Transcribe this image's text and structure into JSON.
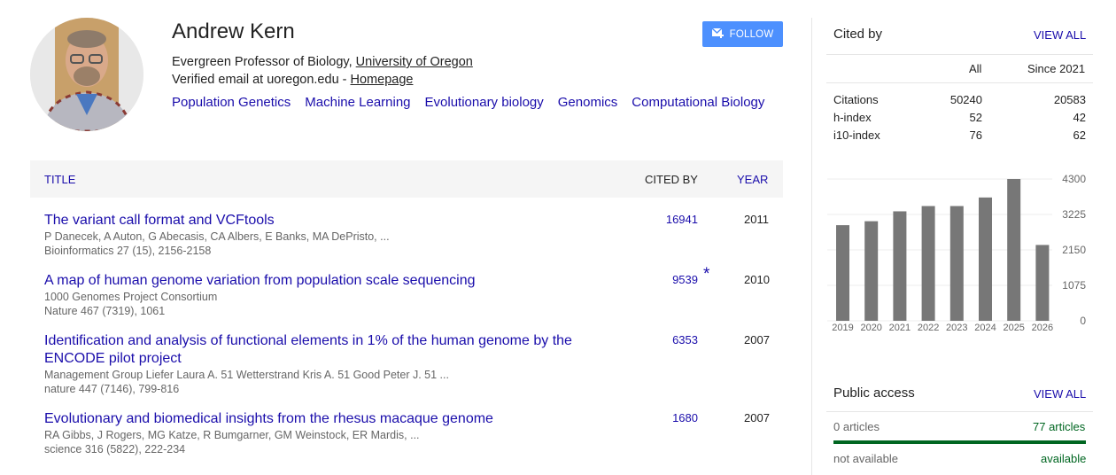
{
  "profile": {
    "name": "Andrew Kern",
    "affiliation_prefix": "Evergreen Professor of Biology, ",
    "affiliation_link": "University of Oregon",
    "email_prefix": "Verified email at uoregon.edu - ",
    "homepage_link": "Homepage",
    "interests": [
      "Population Genetics",
      "Machine Learning",
      "Evolutionary biology",
      "Genomics",
      "Computational Biology"
    ],
    "follow_label": "FOLLOW"
  },
  "table": {
    "headers": {
      "title": "TITLE",
      "cited_by": "CITED BY",
      "year": "YEAR"
    },
    "rows": [
      {
        "title": "The variant call format and VCFtools",
        "authors": "P Danecek, A Auton, G Abecasis, CA Albers, E Banks, MA DePristo, ...",
        "venue": "Bioinformatics 27 (15), 2156-2158",
        "cited": "16941",
        "year": "2011",
        "star": ""
      },
      {
        "title": "A map of human genome variation from population scale sequencing",
        "authors": "1000 Genomes Project Consortium",
        "venue": "Nature 467 (7319), 1061",
        "cited": "9539",
        "year": "2010",
        "star": "*"
      },
      {
        "title": "Identification and analysis of functional elements in 1% of the human genome by the ENCODE pilot project",
        "authors": "Management Group Liefer Laura A. 51 Wetterstrand Kris A. 51 Good Peter J. 51 ...",
        "venue": "nature 447 (7146), 799-816",
        "cited": "6353",
        "year": "2007",
        "star": ""
      },
      {
        "title": "Evolutionary and biomedical insights from the rhesus macaque genome",
        "authors": "RA Gibbs, J Rogers, MG Katze, R Bumgarner, GM Weinstock, ER Mardis, ...",
        "venue": "science 316 (5822), 222-234",
        "cited": "1680",
        "year": "2007",
        "star": ""
      }
    ]
  },
  "cited_by": {
    "heading": "Cited by",
    "view_all": "VIEW ALL",
    "col_all": "All",
    "col_since": "Since 2021",
    "stats": [
      {
        "label": "Citations",
        "all": "50240",
        "since": "20583"
      },
      {
        "label": "h-index",
        "all": "52",
        "since": "42"
      },
      {
        "label": "i10-index",
        "all": "76",
        "since": "62"
      }
    ]
  },
  "chart_data": {
    "type": "bar",
    "categories": [
      "2019",
      "2020",
      "2021",
      "2022",
      "2023",
      "2024",
      "2025",
      "2026"
    ],
    "values": [
      2900,
      3020,
      3320,
      3480,
      3480,
      3740,
      4300,
      2300
    ],
    "ylim": [
      0,
      4300
    ],
    "yticks": [
      "4300",
      "3225",
      "2150",
      "1075",
      "0"
    ],
    "bar_color": "#777777",
    "grid": true
  },
  "public_access": {
    "heading": "Public access",
    "view_all": "VIEW ALL",
    "left_count": "0 articles",
    "right_count": "77 articles",
    "left_status": "not available",
    "right_status": "available",
    "bar_color": "#006621",
    "available_fraction": 1.0
  }
}
